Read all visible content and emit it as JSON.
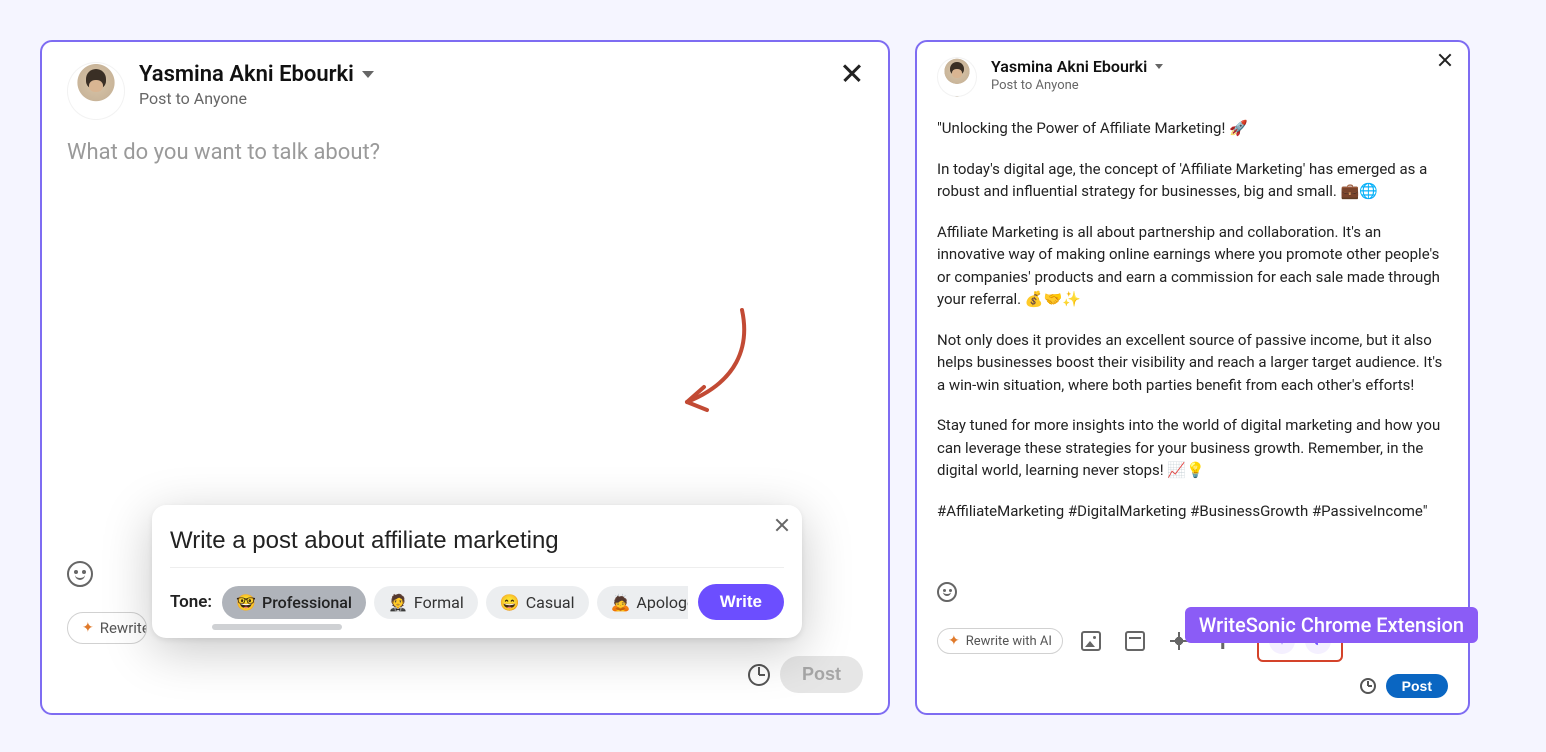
{
  "left": {
    "user_name": "Yasmina Akni Ebourki",
    "post_to": "Post to Anyone",
    "placeholder": "What do you want to talk about?",
    "rewrite_label": "Rewrite with AI",
    "post_label": "Post",
    "popup": {
      "prompt_value": "Write a post about affiliate marketing",
      "tone_label": "Tone:",
      "tones": [
        {
          "emoji": "🤓",
          "label": "Professional",
          "active": true
        },
        {
          "emoji": "🤵",
          "label": "Formal",
          "active": false
        },
        {
          "emoji": "😄",
          "label": "Casual",
          "active": false
        },
        {
          "emoji": "🙇",
          "label": "Apologetic",
          "active": false
        }
      ],
      "write_label": "Write"
    }
  },
  "right": {
    "user_name": "Yasmina Akni Ebourki",
    "post_to": "Post to Anyone",
    "paragraphs": [
      "\"Unlocking the Power of Affiliate Marketing! 🚀",
      "In today's digital age, the concept of 'Affiliate Marketing' has emerged as a robust and influential strategy for businesses, big and small. 💼🌐",
      "Affiliate Marketing is all about partnership and collaboration. It's an innovative way of making online earnings where you promote other people's or companies' products and earn a commission for each sale made through your referral. 💰🤝✨",
      "Not only does it provides an excellent source of passive income, but it also helps businesses boost their visibility and reach a larger target audience. It's a win-win situation, where both parties benefit from each other's efforts!",
      "Stay tuned for more insights into the world of digital marketing and how you can leverage these strategies for your business growth. Remember, in the digital world, learning never stops! 📈💡",
      "#AffiliateMarketing #DigitalMarketing #BusinessGrowth #PassiveIncome\""
    ],
    "rewrite_label": "Rewrite with AI",
    "post_label": "Post",
    "badge": "WriteSonic Chrome Extension"
  }
}
